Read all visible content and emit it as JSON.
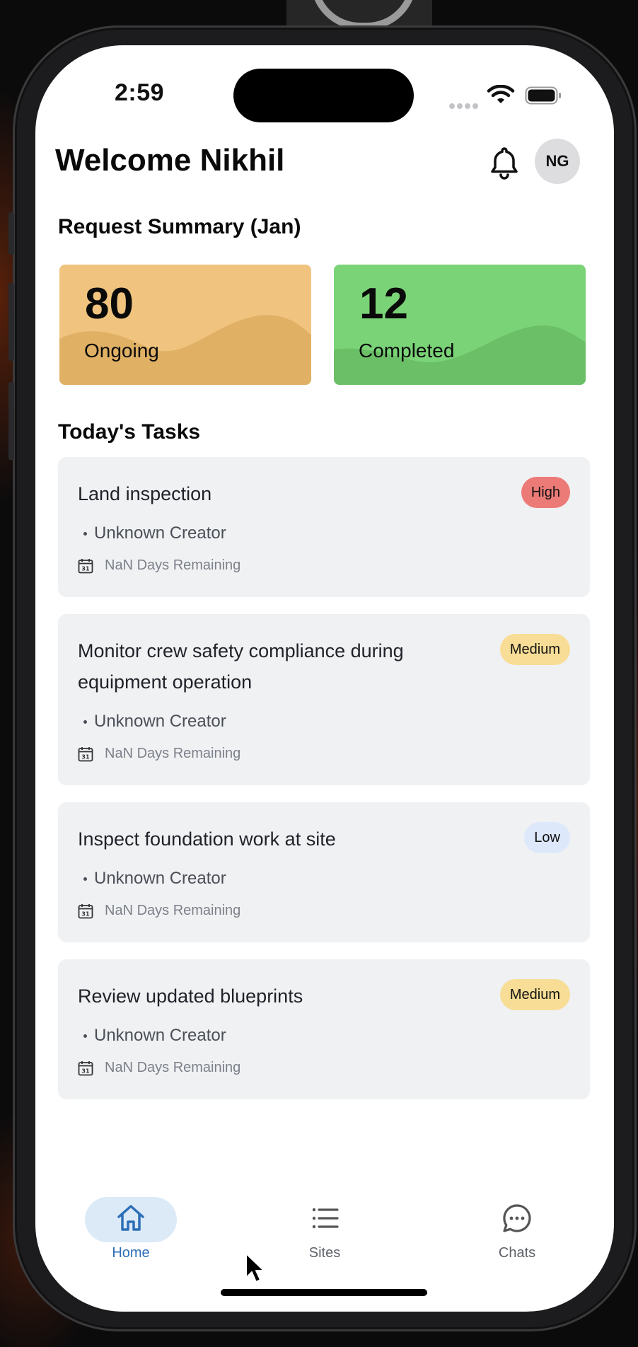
{
  "status_bar": {
    "time": "2:59"
  },
  "header": {
    "title": "Welcome Nikhil",
    "avatar_initials": "NG"
  },
  "summary": {
    "title": "Request Summary (Jan)",
    "cards": [
      {
        "value": "80",
        "label": "Ongoing",
        "color": "#f0c47f",
        "wave_color": "#e0b064"
      },
      {
        "value": "12",
        "label": "Completed",
        "color": "#7ad477",
        "wave_color": "#6bbf66"
      }
    ]
  },
  "tasks_section": {
    "title": "Today's Tasks",
    "tasks": [
      {
        "title": "Land inspection",
        "priority": "High",
        "priority_color": "#ec7b77",
        "creator": "Unknown Creator",
        "remaining": "NaN Days Remaining"
      },
      {
        "title": "Monitor crew safety compliance during equipment operation",
        "priority": "Medium",
        "priority_color": "#f7dd95",
        "creator": "Unknown Creator",
        "remaining": "NaN Days Remaining"
      },
      {
        "title": "Inspect foundation work at site",
        "priority": "Low",
        "priority_color": "#dde8fb",
        "creator": "Unknown Creator",
        "remaining": "NaN Days Remaining"
      },
      {
        "title": "Review updated blueprints",
        "priority": "Medium",
        "priority_color": "#f7dd95",
        "creator": "Unknown Creator",
        "remaining": "NaN Days Remaining"
      }
    ]
  },
  "tab_bar": {
    "tabs": [
      {
        "label": "Home",
        "icon": "home-icon",
        "active": true
      },
      {
        "label": "Sites",
        "icon": "list-icon",
        "active": false
      },
      {
        "label": "Chats",
        "icon": "chat-bubble-icon",
        "active": false
      }
    ],
    "active_color": "#2d6fb7"
  }
}
